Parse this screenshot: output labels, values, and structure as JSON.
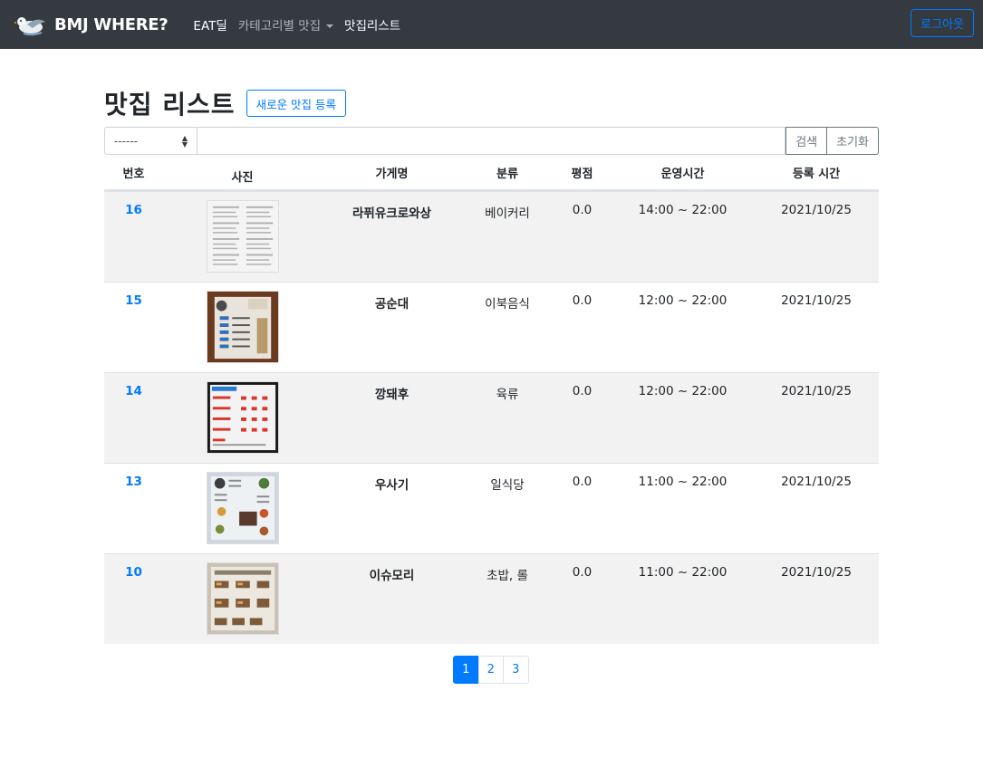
{
  "nav": {
    "brand": "BMJ WHERE?",
    "links": [
      {
        "label": "EAT딜",
        "state": "active"
      },
      {
        "label": "카테고리별 맛집",
        "state": "dropdown"
      },
      {
        "label": "맛집리스트",
        "state": "active"
      }
    ],
    "logout_label": "로그아웃"
  },
  "page": {
    "title": "맛집 리스트",
    "new_button_label": "새로운 맛집 등록"
  },
  "search": {
    "select_value": "------",
    "input_value": "",
    "search_label": "검색",
    "reset_label": "초기화"
  },
  "table": {
    "headers": [
      "번호",
      "사진",
      "가게명",
      "분류",
      "평점",
      "운영시간",
      "등록 시간"
    ],
    "rows": [
      {
        "id": "16",
        "name": "라퓌유크로와상",
        "category": "베이커리",
        "score": "0.0",
        "hours": "14:00 ~ 22:00",
        "date": "2021/10/25",
        "thumb": "menu-list"
      },
      {
        "id": "15",
        "name": "공순대",
        "category": "이북음식",
        "score": "0.0",
        "hours": "12:00 ~ 22:00",
        "date": "2021/10/25",
        "thumb": "menu-board"
      },
      {
        "id": "14",
        "name": "깡돼후",
        "category": "육류",
        "score": "0.0",
        "hours": "12:00 ~ 22:00",
        "date": "2021/10/25",
        "thumb": "menu-red"
      },
      {
        "id": "13",
        "name": "우사기",
        "category": "일식당",
        "score": "0.0",
        "hours": "11:00 ~ 22:00",
        "date": "2021/10/25",
        "thumb": "menu-illustrated"
      },
      {
        "id": "10",
        "name": "이슈모리",
        "category": "초밥, 롤",
        "score": "0.0",
        "hours": "11:00 ~ 22:00",
        "date": "2021/10/25",
        "thumb": "menu-sushi"
      }
    ]
  },
  "pagination": {
    "pages": [
      "1",
      "2",
      "3"
    ],
    "current": "1"
  },
  "colors": {
    "navbar": "#343a40",
    "primary": "#007bff",
    "stripe": "#f2f2f2"
  }
}
